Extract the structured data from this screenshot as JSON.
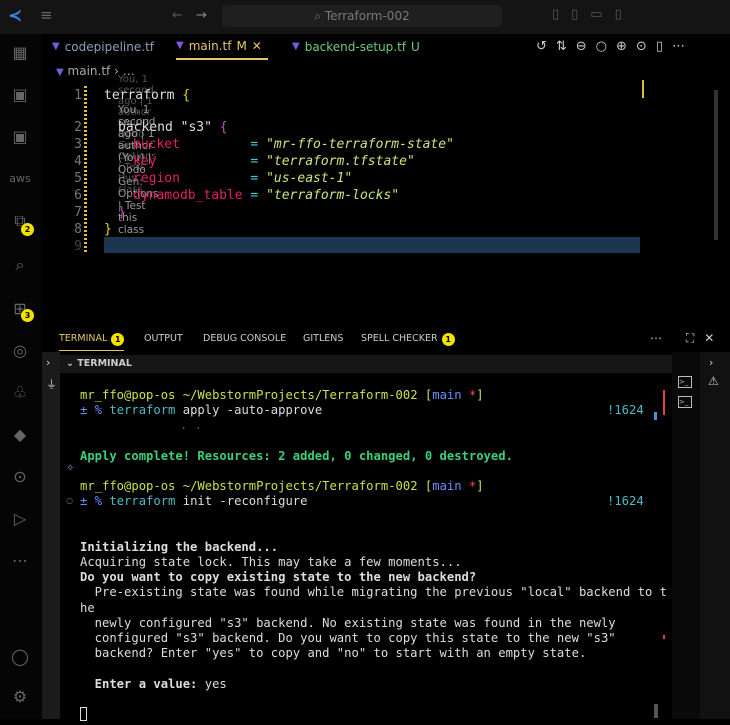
{
  "titlebar": {
    "search": "Terraform-002"
  },
  "activity": {
    "badges": {
      "explorer": "2",
      "extensions": "3"
    },
    "aws_label": "aws"
  },
  "tabs": [
    {
      "label": "codepipeline.tf",
      "status": ""
    },
    {
      "label": "main.tf",
      "status": "M"
    },
    {
      "label": "backend-setup.tf",
      "status": "U"
    }
  ],
  "breadcrumb": {
    "file": "main.tf",
    "rest": "…"
  },
  "editor": {
    "lens_top": "You, 1 second ago | 1 author (You) | Qodo Gen: Options | Test this class",
    "lens": "You, 1 second ago | 1 author (You) | Qodo Gen: Options | Test this class",
    "line_numbers": [
      "1",
      "2",
      "3",
      "4",
      "5",
      "6",
      "7",
      "8",
      "9"
    ],
    "l1_kw": "terraform",
    "brace_open": "{",
    "brace_close": "}",
    "l2_kw": "backend",
    "l2_str": "\"s3\"",
    "attrs": [
      {
        "key": "bucket        ",
        "val": "\"mr-ffo-terraform-state\""
      },
      {
        "key": "key           ",
        "val": "\"terraform.tfstate\""
      },
      {
        "key": "region        ",
        "val": "\"us-east-1\""
      },
      {
        "key": "dynamodb_table",
        "val": "\"terraform-locks\""
      }
    ],
    "eq": "="
  },
  "panel": {
    "tabs": [
      {
        "label": "TERMINAL",
        "badge": "1"
      },
      {
        "label": "OUTPUT"
      },
      {
        "label": "DEBUG CONSOLE"
      },
      {
        "label": "GITLENS"
      },
      {
        "label": "SPELL CHECKER",
        "badge": "1"
      }
    ],
    "header": "TERMINAL"
  },
  "terminal": {
    "user": "mr_ffo",
    "host": "@pop-os",
    "path": " ~/WebstormProjects/Terraform-002 ",
    "branch": "main",
    "dirty": "*",
    "pm": "± % ",
    "tf": "terraform",
    "cmd1": " apply -auto-approve",
    "cmd2": " init -reconfigure",
    "count": "!1624",
    "dots": ". .",
    "apply": "Apply complete! Resources: 2 added, 0 changed, 0 destroyed.",
    "init": "Initializing the backend...",
    "acquiring": "Acquiring state lock. This may take a few moments...",
    "question": "Do you want to copy existing state to the new backend?",
    "msg": [
      "  Pre-existing state was found while migrating the previous \"local\" backend to t",
      "he",
      "  newly configured \"s3\" backend. No existing state was found in the newly",
      "  configured \"s3\" backend. Do you want to copy this state to the new \"s3\"",
      "  backend? Enter \"yes\" to copy and \"no\" to start with an empty state."
    ],
    "enter_label": "  Enter a value:",
    "enter_value": " yes"
  }
}
